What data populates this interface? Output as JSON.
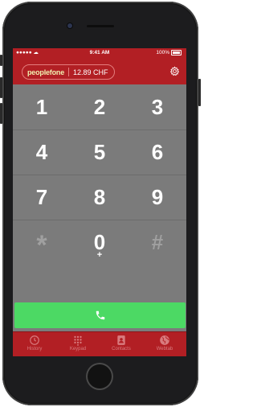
{
  "status": {
    "carrier": "●●●●● ☁",
    "time": "9:41 AM",
    "battery": "100%"
  },
  "header": {
    "brand": "peoplefone",
    "credit": "12.89 CHF",
    "settings_icon": "gear-icon"
  },
  "keypad": {
    "keys": [
      {
        "label": "1",
        "sub": ""
      },
      {
        "label": "2",
        "sub": ""
      },
      {
        "label": "3",
        "sub": ""
      },
      {
        "label": "4",
        "sub": ""
      },
      {
        "label": "5",
        "sub": ""
      },
      {
        "label": "6",
        "sub": ""
      },
      {
        "label": "7",
        "sub": ""
      },
      {
        "label": "8",
        "sub": ""
      },
      {
        "label": "9",
        "sub": ""
      },
      {
        "label": "*",
        "sub": ""
      },
      {
        "label": "0",
        "sub": "+"
      },
      {
        "label": "#",
        "sub": ""
      }
    ]
  },
  "call": {
    "icon": "phone-icon",
    "color": "#4cd964"
  },
  "tabs": [
    {
      "label": "History",
      "icon": "clock-icon"
    },
    {
      "label": "Keypad",
      "icon": "keypad-icon"
    },
    {
      "label": "Contacts",
      "icon": "contacts-icon"
    },
    {
      "label": "Webtab",
      "icon": "globe-icon"
    }
  ],
  "colors": {
    "brand_red": "#b21f24",
    "keypad_bg": "#7b7b7b",
    "call_green": "#4cd964"
  }
}
